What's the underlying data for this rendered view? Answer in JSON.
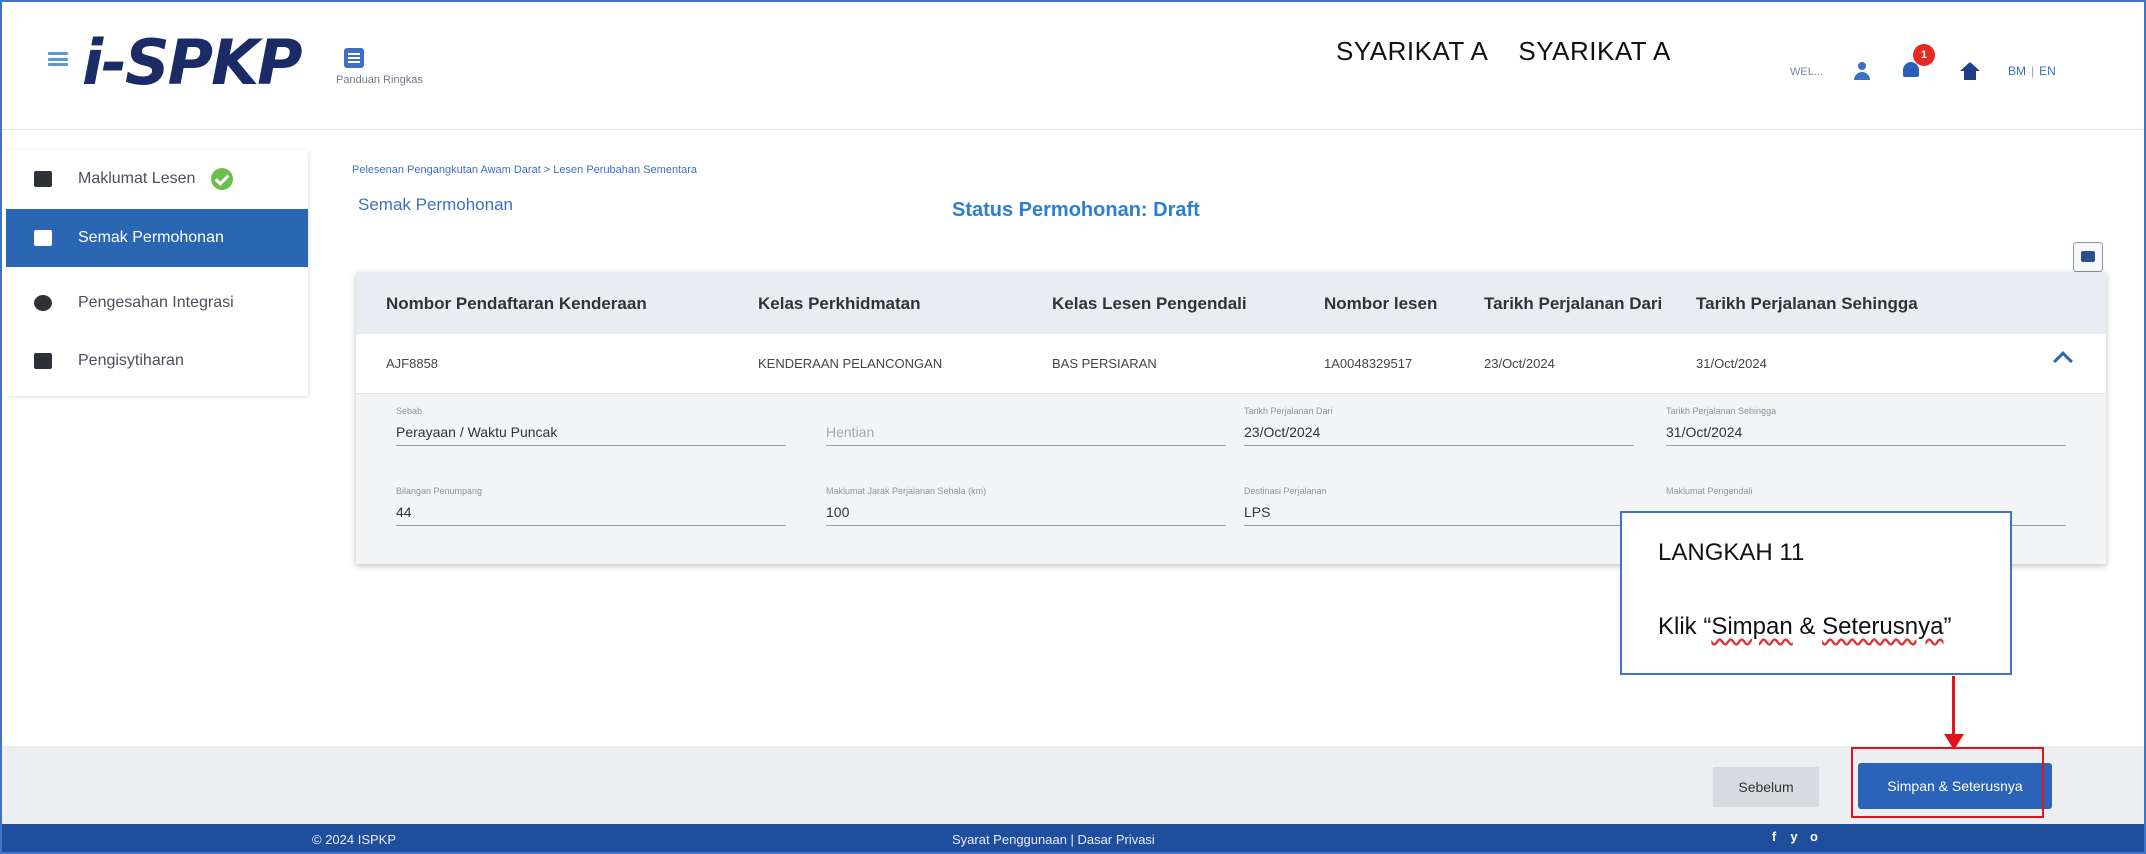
{
  "header": {
    "logo_text": "i-SPKP",
    "help_label": "Panduan Ringkas",
    "company_names": [
      "SYARIKAT A",
      "SYARIKAT A"
    ],
    "user_suffix": "WEL...",
    "notification_count": "1",
    "lang_bm": "BM",
    "lang_en": "EN",
    "lang_sep": "|"
  },
  "sidebar": {
    "items": [
      {
        "label": "Maklumat Lesen",
        "icon": "folder-icon",
        "completed": true
      },
      {
        "label": "Semak Permohonan",
        "icon": "chat-icon",
        "active": true
      },
      {
        "label": "Pengesahan Integrasi",
        "icon": "verified-icon"
      },
      {
        "label": "Pengisytiharan",
        "icon": "clipboard-icon"
      }
    ]
  },
  "main": {
    "breadcrumb": "Pelesenan Pengangkutan Awam Darat > Lesen Perubahan Sementara",
    "step_title": "Semak Permohonan",
    "status": "Status Permohonan: Draft",
    "table": {
      "headers": [
        "Nombor Pendaftaran Kenderaan",
        "Kelas Perkhidmatan",
        "Kelas Lesen Pengendali",
        "Nombor lesen",
        "Tarikh Perjalanan Dari",
        "Tarikh Perjalanan Sehingga"
      ],
      "row": [
        "AJF8858",
        "KENDERAAN PELANCONGAN",
        "BAS PERSIARAN",
        "1A0048329517",
        "23/Oct/2024",
        "31/Oct/2024"
      ]
    },
    "details": {
      "sebab_label": "Sebab",
      "sebab_value": "Perayaan / Waktu Puncak",
      "hentian_value": "Hentian",
      "dari_label": "Tarikh Perjalanan Dari",
      "dari_value": "23/Oct/2024",
      "sehingga_label": "Tarikh Perjalanan Sehingga",
      "sehingga_value": "31/Oct/2024",
      "penumpang_label": "Bilangan Penumpang",
      "penumpang_value": "44",
      "jarak_label": "Maklumat Jarak Perjalanan Sehala (km)",
      "jarak_value": "100",
      "destinasi_label": "Destinasi Perjalanan",
      "destinasi_value": "LPS",
      "pengendali_label": "Maklumat Pengendali"
    }
  },
  "callout": {
    "title": "LANGKAH 11",
    "text_prefix": "Klik “",
    "text_word1": "Simpan",
    "text_amp": " & ",
    "text_word2": "Seterusnya",
    "text_suffix": "”"
  },
  "actions": {
    "prev_label": "Sebelum",
    "next_label": "Simpan & Seterusnya"
  },
  "footer": {
    "copyright": "© 2024 ISPKP",
    "links": "Syarat Penggunaan | Dasar Privasi",
    "social": [
      "f",
      "y",
      "o"
    ]
  },
  "colors": {
    "primary": "#2b66b3",
    "footer": "#1f4f9c",
    "callout_arrow": "#e1141c",
    "success": "#6cbf4a"
  }
}
